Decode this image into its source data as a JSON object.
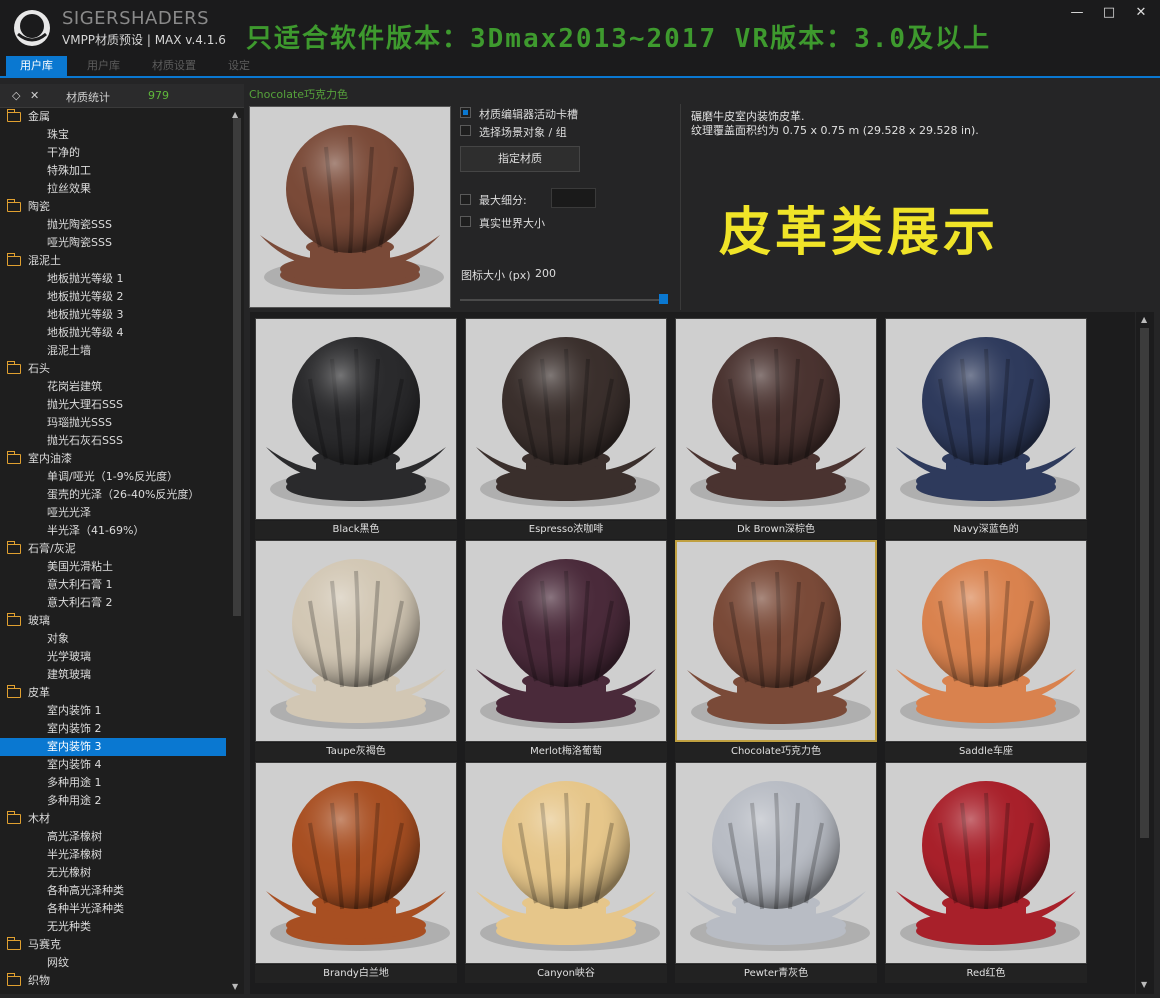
{
  "app": {
    "brand": "SIGERSHADERS",
    "subtitle": "VMPP材质预设 | MAX v.4.1.6",
    "banner": "只适合软件版本：3Dmax2013~2017  VR版本：3.0及以上",
    "window_buttons": [
      "—",
      "□",
      "✕"
    ]
  },
  "tabs": [
    "用户库",
    "用户库",
    "材质设置",
    "设定"
  ],
  "left_header": {
    "title": "材质统计",
    "count": "979"
  },
  "tree": [
    {
      "label": "金属",
      "children": [
        "珠宝",
        "干净的",
        "特殊加工",
        "拉丝效果"
      ]
    },
    {
      "label": "陶瓷",
      "children": [
        "抛光陶瓷SSS",
        "哑光陶瓷SSS"
      ]
    },
    {
      "label": "混泥土",
      "children": [
        "地板抛光等级 1",
        "地板抛光等级 2",
        "地板抛光等级 3",
        "地板抛光等级 4",
        "混泥土墙"
      ]
    },
    {
      "label": "石头",
      "children": [
        "花岗岩建筑",
        "抛光大理石SSS",
        "玛瑙抛光SSS",
        "抛光石灰石SSS"
      ]
    },
    {
      "label": "室内油漆",
      "children": [
        "单调/哑光（1-9%反光度）",
        "蛋壳的光泽（26-40%反光度）",
        "哑光光泽",
        "半光泽（41-69%）"
      ]
    },
    {
      "label": "石膏/灰泥",
      "children": [
        "美国光滑粘土",
        "意大利石膏 1",
        "意大利石膏 2"
      ]
    },
    {
      "label": "玻璃",
      "children": [
        "对象",
        "光学玻璃",
        "建筑玻璃"
      ]
    },
    {
      "label": "皮革",
      "children": [
        "室内装饰 1",
        "室内装饰 2",
        "室内装饰 3",
        "室内装饰 4",
        "多种用途 1",
        "多种用途 2"
      ]
    },
    {
      "label": "木材",
      "children": [
        "高光泽橡树",
        "半光泽橡树",
        "无光橡树",
        "各种高光泽种类",
        "各种半光泽种类",
        "无光种类"
      ]
    },
    {
      "label": "马赛克",
      "children": [
        "网纹"
      ]
    },
    {
      "label": "织物",
      "children": []
    }
  ],
  "selected_item": "室内装饰 3",
  "material": {
    "name": "Chocolate巧克力色",
    "color": "#7a4a38",
    "options": {
      "editor_slot": "材质编辑器活动卡槽",
      "select_scene": "选择场景对象 / 组",
      "assign_button": "指定材质",
      "max_subdiv": "最大细分:",
      "real_world": "真实世界大小",
      "icon_size_label": "图标大小 (px)",
      "icon_size_value": "200",
      "icon_size_fraction": 1.0
    },
    "description": [
      "碾磨牛皮室内装饰皮革.",
      "纹理覆盖面积约为 0.75 x 0.75 m (29.528 x 29.528 in)."
    ],
    "showcase_text": "皮革类展示"
  },
  "materials": [
    {
      "caption": "Black黑色",
      "color": "#2a2a2c",
      "selected": false
    },
    {
      "caption": "Espresso浓咖啡",
      "color": "#3a2f2c",
      "selected": false
    },
    {
      "caption": "Dk Brown深棕色",
      "color": "#4a3330",
      "selected": false
    },
    {
      "caption": "Navy深蓝色的",
      "color": "#2e3a5c",
      "selected": false
    },
    {
      "caption": "Taupe灰褐色",
      "color": "#d2c7b4",
      "selected": false
    },
    {
      "caption": "Merlot梅洛葡萄",
      "color": "#4a2a3a",
      "selected": false
    },
    {
      "caption": "Chocolate巧克力色",
      "color": "#7a4a38",
      "selected": true
    },
    {
      "caption": "Saddle车座",
      "color": "#d9824e",
      "selected": false
    },
    {
      "caption": "Brandy白兰地",
      "color": "#a84f22",
      "selected": false
    },
    {
      "caption": "Canyon峡谷",
      "color": "#e6c68a",
      "selected": false
    },
    {
      "caption": "Pewter青灰色",
      "color": "#b8bcc4",
      "selected": false
    },
    {
      "caption": "Red红色",
      "color": "#a8202a",
      "selected": false
    }
  ],
  "colors": {
    "accent": "#0a78d1",
    "banner": "#3e9a2e",
    "showcase": "#f0e428",
    "title_green": "#56a23b"
  }
}
